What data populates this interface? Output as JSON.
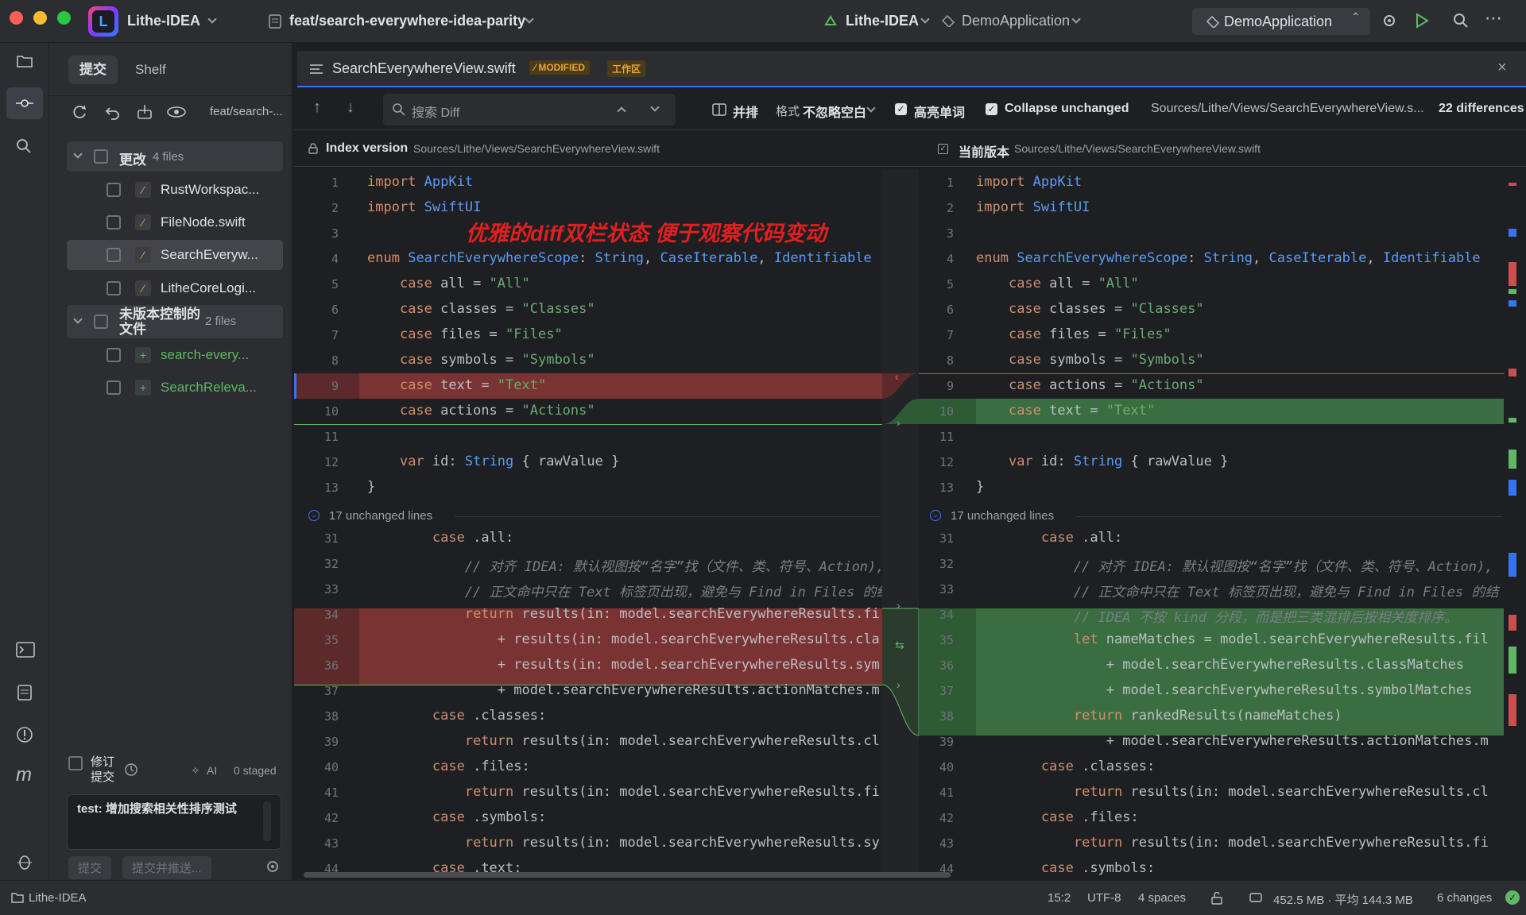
{
  "titlebar": {
    "project": "Lithe-IDEA",
    "branch": "feat/search-everywhere-idea-parity",
    "vcs_project": "Lithe-IDEA",
    "module": "DemoApplication",
    "run_config": "DemoApplication"
  },
  "commit_panel": {
    "tab_commit": "提交",
    "tab_shelf": "Shelf",
    "branch_label": "feat/search-...",
    "changes_group": "更改",
    "changes_count": "4 files",
    "files": [
      "RustWorkspac...",
      "FileNode.swift",
      "SearchEveryw...",
      "LitheCoreLogi..."
    ],
    "unversioned_group": "未版本控制的文件",
    "unversioned_count": "2 files",
    "unversioned_files": [
      "search-every...",
      "SearchReleva..."
    ],
    "amend_label": "修订提交",
    "ai_label": "AI",
    "staged_label": "0 staged",
    "commit_message": "test: 增加搜索相关性排序测试",
    "commit_button": "提交",
    "commit_push_button": "提交并推送..."
  },
  "editor": {
    "tab_title": "SearchEverywhereView.swift",
    "badge_modified": "MODIFIED",
    "badge_worktree": "工作区",
    "search_placeholder": "搜索 Diff",
    "side_by_side": "并排",
    "format_label": "格式",
    "whitespace_option": "不忽略空白",
    "highlight_words": "高亮单词",
    "collapse_unchanged": "Collapse unchanged",
    "path": "Sources/Lithe/Views/SearchEverywhereView.s...",
    "differences": "22 differences",
    "left_title": "Index version",
    "left_path": "Sources/Lithe/Views/SearchEverywhereView.swift",
    "right_title": "当前版本",
    "right_path": "Sources/Lithe/Views/SearchEverywhereView.swift",
    "annotation": "优雅的diff双栏状态 便于观察代码变动",
    "unchanged_left": "17 unchanged lines",
    "unchanged_right": "17 unchanged lines"
  },
  "left_lines": [
    {
      "n": "1",
      "code": "import AppKit"
    },
    {
      "n": "2",
      "code": "import SwiftUI"
    },
    {
      "n": "3",
      "code": ""
    },
    {
      "n": "4",
      "code": "enum SearchEverywhereScope: String, CaseIterable, Identifiable"
    },
    {
      "n": "5",
      "code": "    case all = \"All\""
    },
    {
      "n": "6",
      "code": "    case classes = \"Classes\""
    },
    {
      "n": "7",
      "code": "    case files = \"Files\""
    },
    {
      "n": "8",
      "code": "    case symbols = \"Symbols\""
    },
    {
      "n": "9",
      "code": "    case text = \"Text\""
    },
    {
      "n": "10",
      "code": "    case actions = \"Actions\""
    },
    {
      "n": "11",
      "code": ""
    },
    {
      "n": "12",
      "code": "    var id: String { rawValue }"
    },
    {
      "n": "13",
      "code": "}"
    },
    {
      "n": "31",
      "code": "        case .all:"
    },
    {
      "n": "32",
      "code": "            // 对齐 IDEA: 默认视图按“名字”找（文件、类、符号、Action),"
    },
    {
      "n": "33",
      "code": "            // 正文命中只在 Text 标签页出现，避免与 Find in Files 的结"
    },
    {
      "n": "34",
      "code": "            return results(in: model.searchEverywhereResults.fi"
    },
    {
      "n": "35",
      "code": "                + results(in: model.searchEverywhereResults.cla"
    },
    {
      "n": "36",
      "code": "                + results(in: model.searchEverywhereResults.sym"
    },
    {
      "n": "37",
      "code": "                + model.searchEverywhereResults.actionMatches.m"
    },
    {
      "n": "38",
      "code": "        case .classes:"
    },
    {
      "n": "39",
      "code": "            return results(in: model.searchEverywhereResults.cl"
    },
    {
      "n": "40",
      "code": "        case .files:"
    },
    {
      "n": "41",
      "code": "            return results(in: model.searchEverywhereResults.fi"
    },
    {
      "n": "42",
      "code": "        case .symbols:"
    },
    {
      "n": "43",
      "code": "            return results(in: model.searchEverywhereResults.sy"
    },
    {
      "n": "44",
      "code": "        case .text:"
    }
  ],
  "right_lines": [
    {
      "n": "1",
      "code": "import AppKit"
    },
    {
      "n": "2",
      "code": "import SwiftUI"
    },
    {
      "n": "3",
      "code": ""
    },
    {
      "n": "4",
      "code": "enum SearchEverywhereScope: String, CaseIterable, Identifiable"
    },
    {
      "n": "5",
      "code": "    case all = \"All\""
    },
    {
      "n": "6",
      "code": "    case classes = \"Classes\""
    },
    {
      "n": "7",
      "code": "    case files = \"Files\""
    },
    {
      "n": "8",
      "code": "    case symbols = \"Symbols\""
    },
    {
      "n": "9",
      "code": "    case actions = \"Actions\""
    },
    {
      "n": "10",
      "code": "    case text = \"Text\""
    },
    {
      "n": "11",
      "code": ""
    },
    {
      "n": "12",
      "code": "    var id: String { rawValue }"
    },
    {
      "n": "13",
      "code": "}"
    },
    {
      "n": "31",
      "code": "        case .all:"
    },
    {
      "n": "32",
      "code": "            // 对齐 IDEA: 默认视图按“名字”找（文件、类、符号、Action),"
    },
    {
      "n": "33",
      "code": "            // 正文命中只在 Text 标签页出现，避免与 Find in Files 的结"
    },
    {
      "n": "34",
      "code": "            // IDEA 不按 kind 分段，而是把三类混排后按相关度排序。"
    },
    {
      "n": "35",
      "code": "            let nameMatches = model.searchEverywhereResults.fil"
    },
    {
      "n": "36",
      "code": "                + model.searchEverywhereResults.classMatches"
    },
    {
      "n": "37",
      "code": "                + model.searchEverywhereResults.symbolMatches"
    },
    {
      "n": "38",
      "code": "            return rankedResults(nameMatches)"
    },
    {
      "n": "39",
      "code": "                + model.searchEverywhereResults.actionMatches.m"
    },
    {
      "n": "40",
      "code": "        case .classes:"
    },
    {
      "n": "41",
      "code": "            return results(in: model.searchEverywhereResults.cl"
    },
    {
      "n": "42",
      "code": "        case .files:"
    },
    {
      "n": "43",
      "code": "            return results(in: model.searchEverywhereResults.fi"
    },
    {
      "n": "44",
      "code": "        case .symbols:"
    }
  ],
  "status": {
    "project": "Lithe-IDEA",
    "position": "15:2",
    "encoding": "UTF-8",
    "indent": "4 spaces",
    "memory": "452.5 MB · 平均 144.3 MB",
    "changes": "6 changes"
  },
  "colors": {
    "accent": "#3574f0",
    "deleted": "#5c2a2a",
    "added": "#2e5a34",
    "annotation": "#e02020"
  }
}
